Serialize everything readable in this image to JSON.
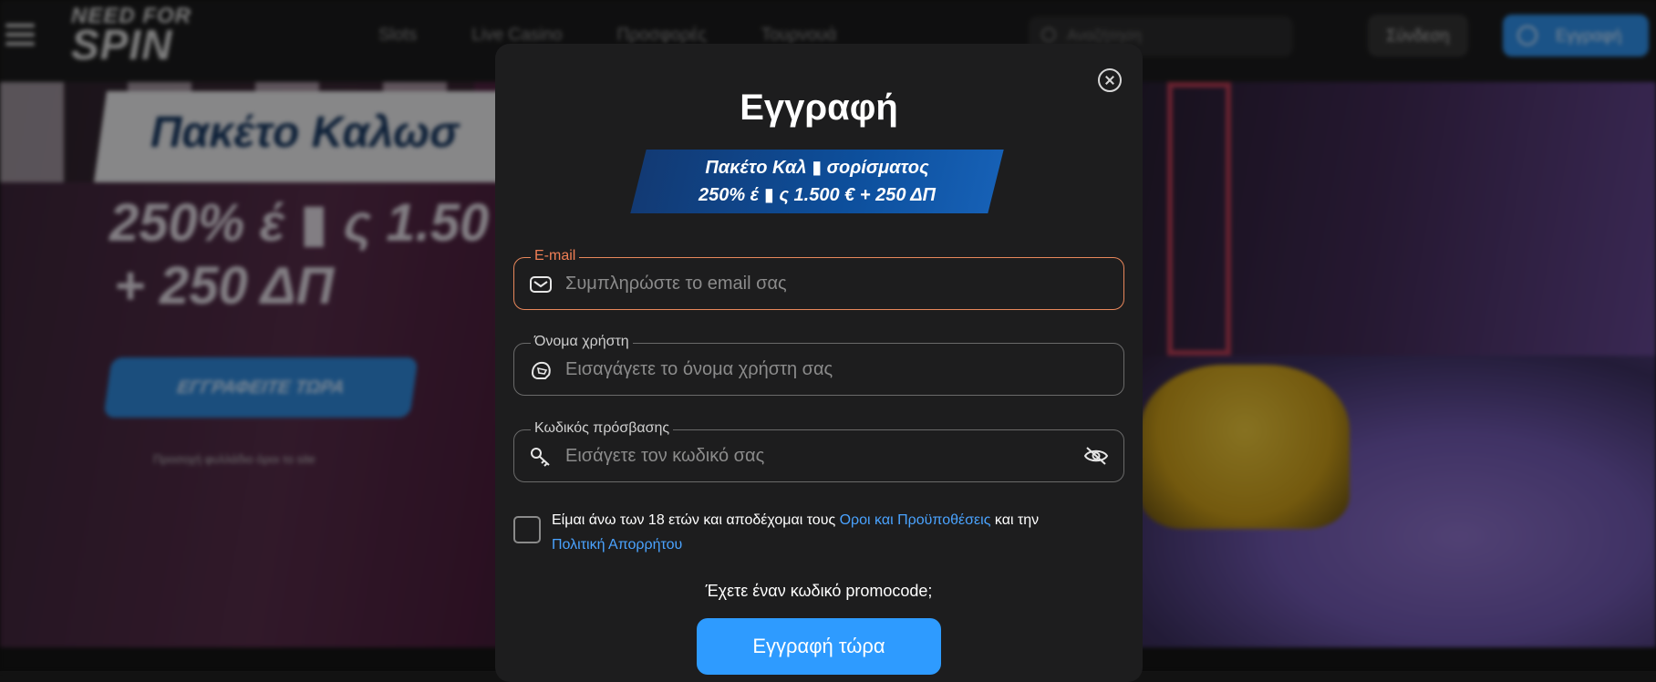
{
  "header": {
    "logo_line1": "NEED FOR",
    "logo_line2": "SPIN",
    "nav": [
      "Slots",
      "Live Casino",
      "Προσφορές",
      "Τουρνουά"
    ],
    "search_placeholder": "Αναζήτηση",
    "login_label": "Σύνδεση",
    "signup_label": "Εγγραφή"
  },
  "hero": {
    "banner_title": "Πακέτο Καλωσ",
    "line1": "250% έ ▮ ς 1.50",
    "line2": "+ 250 ΔΠ",
    "cta_label": "ΕΓΓΡΑΦΕΙΤΕ ΤΩΡΑ",
    "small_text": "Προσοχή φυλλάδιο όροι το site"
  },
  "modal": {
    "title": "Εγγραφή",
    "promo_line1": "Πακέτο Καλ ▮ σορίσματος",
    "promo_line2": "250% έ ▮ ς 1.500 € + 250 ΔΠ",
    "email": {
      "label": "E-mail",
      "placeholder": "Συμπληρώστε το email σας",
      "value": ""
    },
    "username": {
      "label": "Όνομα χρήστη",
      "placeholder": "Εισαγάγετε το όνομα χρήστη σας",
      "value": ""
    },
    "password": {
      "label": "Κωδικός πρόσβασης",
      "placeholder": "Εισάγετε τον κωδικό σας",
      "value": ""
    },
    "terms_text_1": "Είμαι άνω των 18 ετών και αποδέχομαι τους ",
    "terms_link_1": "Οροι και Προϋποθέσεις",
    "terms_text_2": " και την ",
    "terms_link_2": "Πολιτική Απορρήτου",
    "promo_question": "Έχετε έναν κωδικό promocode;",
    "submit_label": "Εγγραφή τώρα"
  },
  "colors": {
    "accent_blue": "#2e9bff",
    "active_border": "#e8875b",
    "link": "#4aa3ff",
    "modal_bg": "#1d1d1e"
  },
  "icons": {
    "email": "envelope-icon",
    "username": "helmet-icon",
    "password": "key-icon",
    "password_toggle": "eye-off-icon",
    "close": "close-icon"
  }
}
